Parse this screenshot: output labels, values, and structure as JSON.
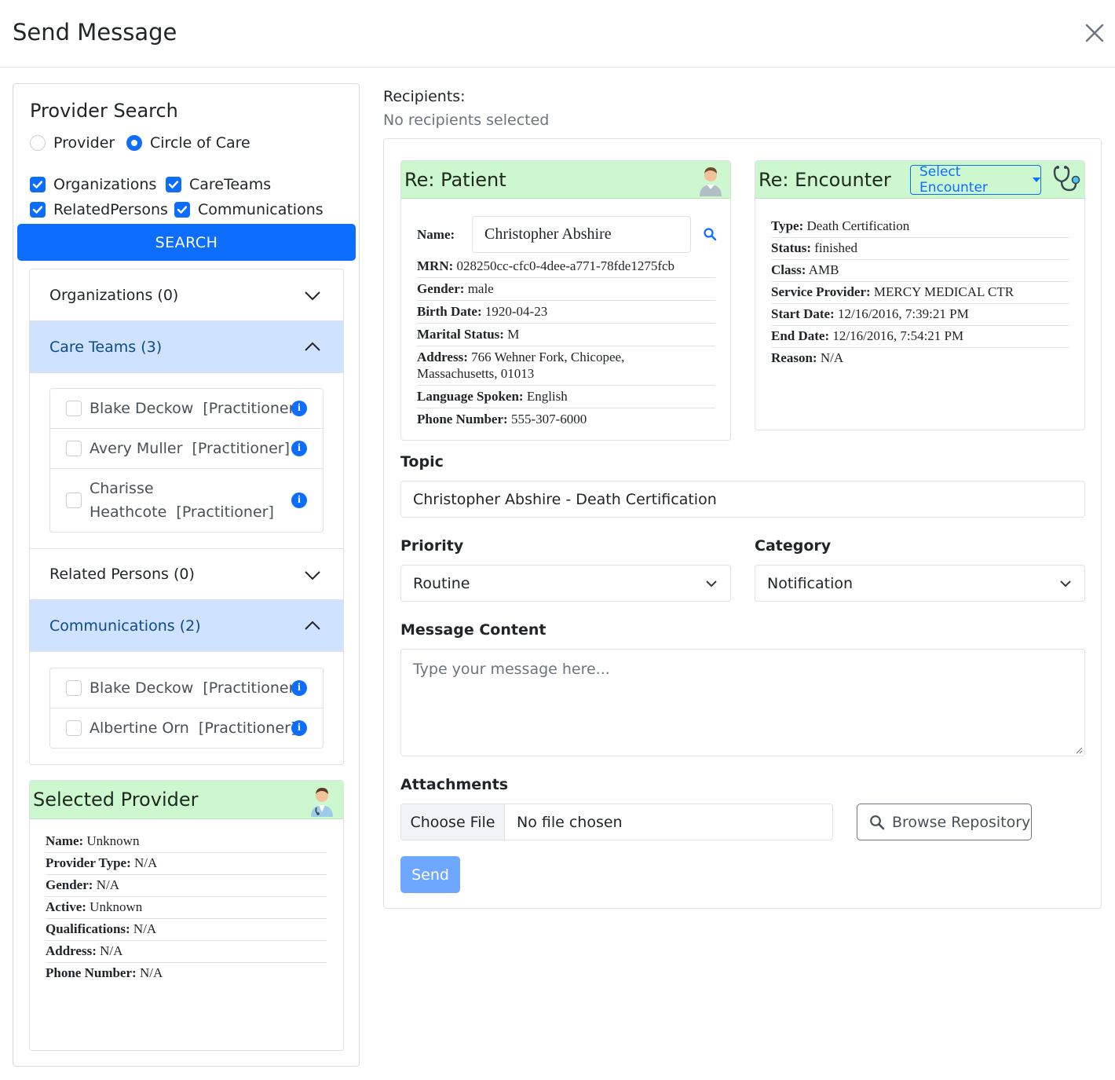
{
  "header": {
    "title": "Send Message"
  },
  "provider_search": {
    "title": "Provider Search",
    "radios": [
      {
        "label": "Provider",
        "checked": false
      },
      {
        "label": "Circle of Care",
        "checked": true
      }
    ],
    "checkboxes": [
      {
        "label": "Organizations",
        "checked": true
      },
      {
        "label": "CareTeams",
        "checked": true
      },
      {
        "label": "RelatedPersons",
        "checked": true
      },
      {
        "label": "Communications",
        "checked": true
      }
    ],
    "search_label": "SEARCH",
    "sections": [
      {
        "label": "Organizations (0)",
        "open": false
      },
      {
        "label": "Care Teams (3)",
        "open": true,
        "items": [
          {
            "name": "Blake Deckow",
            "role": "[Practitioner]"
          },
          {
            "name": "Avery Muller",
            "role": "[Practitioner]"
          },
          {
            "name": "Charisse Heathcote",
            "role": "[Practitioner]",
            "line1": "Charisse",
            "line2": "Heathcote  [Practitioner]"
          }
        ]
      },
      {
        "label": "Related Persons (0)",
        "open": false
      },
      {
        "label": "Communications (2)",
        "open": true,
        "items": [
          {
            "name": "Blake Deckow",
            "role": "[Practitioner]"
          },
          {
            "name": "Albertine Orn",
            "role": "[Practitioner]"
          }
        ]
      }
    ]
  },
  "selected_provider": {
    "title": "Selected Provider",
    "fields": [
      {
        "label": "Name:",
        "value": "Unknown"
      },
      {
        "label": "Provider Type:",
        "value": "N/A"
      },
      {
        "label": "Gender:",
        "value": "N/A"
      },
      {
        "label": "Active:",
        "value": "Unknown"
      },
      {
        "label": "Qualifications:",
        "value": "N/A"
      },
      {
        "label": "Address:",
        "value": "N/A"
      },
      {
        "label": "Phone Number:",
        "value": "N/A"
      }
    ]
  },
  "recipients": {
    "label": "Recipients:",
    "value": "No recipients selected"
  },
  "patient": {
    "title": "Re: Patient",
    "name_label": "Name:",
    "name_value": "Christopher Abshire",
    "fields": [
      {
        "label": "MRN:",
        "value": "028250cc-cfc0-4dee-a771-78fde1275fcb"
      },
      {
        "label": "Gender:",
        "value": "male"
      },
      {
        "label": "Birth Date:",
        "value": "1920-04-23"
      },
      {
        "label": "Marital Status:",
        "value": "M"
      },
      {
        "label": "Address:",
        "value": "766 Wehner Fork, Chicopee, Massachusetts, 01013"
      },
      {
        "label": "Language Spoken:",
        "value": "English"
      },
      {
        "label": "Phone Number:",
        "value": "555-307-6000"
      }
    ]
  },
  "encounter": {
    "title": "Re: Encounter",
    "select_label": "Select Encounter",
    "fields": [
      {
        "label": "Type:",
        "value": "Death Certification"
      },
      {
        "label": "Status:",
        "value": "finished"
      },
      {
        "label": "Class:",
        "value": "AMB"
      },
      {
        "label": "Service Provider:",
        "value": "MERCY MEDICAL CTR"
      },
      {
        "label": "Start Date:",
        "value": "12/16/2016, 7:39:21 PM"
      },
      {
        "label": "End Date:",
        "value": "12/16/2016, 7:54:21 PM"
      },
      {
        "label": "Reason:",
        "value": "N/A"
      }
    ]
  },
  "form": {
    "topic_label": "Topic",
    "topic_value": "Christopher Abshire - Death Certification",
    "priority_label": "Priority",
    "priority_value": "Routine",
    "category_label": "Category",
    "category_value": "Notification",
    "content_label": "Message Content",
    "content_placeholder": "Type your message here...",
    "attachments_label": "Attachments",
    "choose_file_label": "Choose File",
    "no_file_label": "No file chosen",
    "browse_label": "Browse Repository",
    "send_label": "Send"
  },
  "colors": {
    "primary": "#0d6efd",
    "card_header": "#cdf7cf",
    "accordion_open": "#cfe2ff",
    "send_disabled": "#6ea8fe"
  }
}
